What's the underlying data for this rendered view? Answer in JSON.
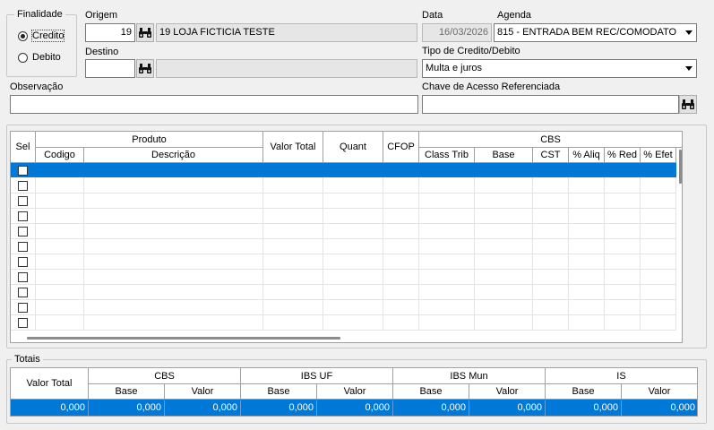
{
  "finalidade": {
    "legend": "Finalidade",
    "options": [
      {
        "label": "Credito",
        "selected": true
      },
      {
        "label": "Debito",
        "selected": false
      }
    ]
  },
  "origem": {
    "label": "Origem",
    "code": "19",
    "name": "19 LOJA FICTICIA TESTE"
  },
  "destino": {
    "label": "Destino",
    "code": "",
    "name": ""
  },
  "data": {
    "label": "Data",
    "value": "16/03/2026"
  },
  "agenda": {
    "label": "Agenda",
    "value": "815 - ENTRADA BEM REC/COMODATO"
  },
  "tipo": {
    "label": "Tipo de Credito/Debito",
    "value": "Multa e juros"
  },
  "observacao": {
    "label": "Observação",
    "value": ""
  },
  "chave": {
    "label": "Chave de Acesso Referenciada",
    "value": ""
  },
  "grid": {
    "col_sel": "Sel",
    "group_produto": "Produto",
    "col_codigo": "Codigo",
    "col_descricao": "Descrição",
    "col_valor_total": "Valor Total",
    "col_quant": "Quant",
    "col_cfop": "CFOP",
    "group_cbs": "CBS",
    "col_class_trib": "Class Trib",
    "col_base": "Base",
    "col_cst": "CST",
    "col_aliq": "% Aliq",
    "col_red": "% Red",
    "col_efet": "% Efet"
  },
  "totais": {
    "legend": "Totais",
    "valor_total_label": "Valor Total",
    "groups": [
      "CBS",
      "IBS UF",
      "IBS Mun",
      "IS"
    ],
    "base_label": "Base",
    "valor_label": "Valor",
    "values": [
      "0,000",
      "0,000",
      "0,000",
      "0,000",
      "0,000",
      "0,000",
      "0,000",
      "0,000",
      "0,000"
    ]
  },
  "colors": {
    "selection": "#0078d7",
    "window": "#f0f0f0"
  }
}
